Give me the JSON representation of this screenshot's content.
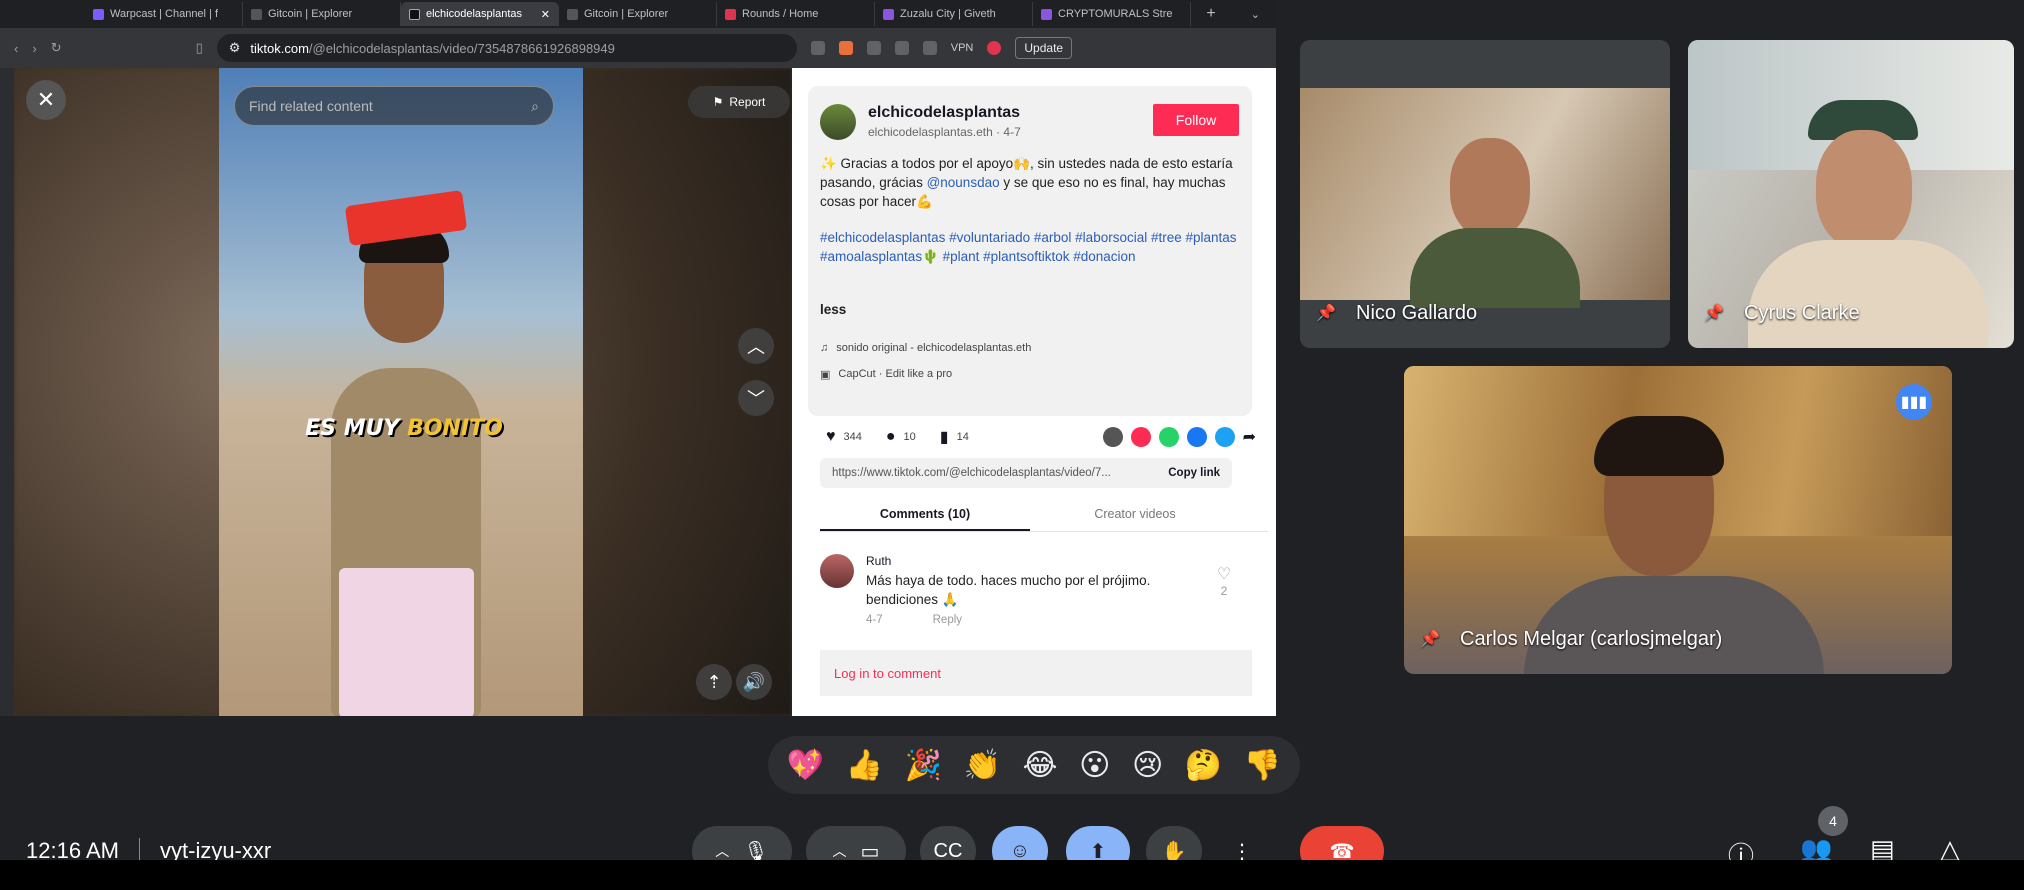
{
  "browser": {
    "tabs": [
      {
        "label": "Warpcast | Channel | f",
        "color": "#7c5cff",
        "active": false
      },
      {
        "label": "Gitcoin | Explorer",
        "color": "#555555",
        "active": false
      },
      {
        "label": "elchicodelasplantas",
        "color": "#111111",
        "active": true
      },
      {
        "label": "Gitcoin | Explorer",
        "color": "#555555",
        "active": false
      },
      {
        "label": "Rounds / Home",
        "color": "#e0334f",
        "active": false
      },
      {
        "label": "Zuzalu City | Giveth",
        "color": "#8a55e0",
        "active": false
      },
      {
        "label": "CRYPTOMURALS Stre",
        "color": "#8a55e0",
        "active": false
      }
    ],
    "url_host": "tiktok.com",
    "url_path": "/@elchicodelasplantas/video/7354878661926898949",
    "vpn_label": "VPN",
    "update_label": "Update"
  },
  "video": {
    "search_placeholder": "Find related content",
    "report_label": "Report",
    "caption_white": "ES MUY",
    "caption_yellow": "BONITO"
  },
  "post": {
    "author": "elchicodelasplantas",
    "author_sub": "elchicodelasplantas.eth · 4-7",
    "follow_label": "Follow",
    "desc_1": "✨ Gracias a todos por el apoyo🙌, sin ustedes nada de esto estaría pasando, grácias ",
    "desc_mention": "@nounsdao",
    "desc_2": " y se que eso no es final, hay muchas cosas por hacer💪",
    "tags": "#elchicodelasplantas #voluntariado #arbol #laborsocial #tree #plantas #amoalasplantas🌵 #plant #plantsoftiktok #donacion",
    "less_label": "less",
    "sound": "sonido original - elchicodelasplantas.eth",
    "capcut": "CapCut · Edit like a pro",
    "likes": "344",
    "comments": "10",
    "saves": "14",
    "share_link": "https://www.tiktok.com/@elchicodelasplantas/video/7...",
    "copy_link_label": "Copy link",
    "tab_comments": "Comments (10)",
    "tab_creator": "Creator videos",
    "comment_user": "Ruth",
    "comment_text": "Más haya de todo. haces mucho por el prójimo. bendiciones 🙏",
    "comment_date": "4-7",
    "comment_reply": "Reply",
    "comment_likes": "2",
    "login_label": "Log in to comment"
  },
  "meet": {
    "participants": [
      {
        "name": "Nico Gallardo"
      },
      {
        "name": "Cyrus Clarke"
      },
      {
        "name": "Carlos Melgar (carlosjmelgar)"
      }
    ],
    "reactions": [
      "💖",
      "👍",
      "🎉",
      "👏",
      "😂",
      "😮",
      "😢",
      "🤔",
      "👎"
    ],
    "time": "12:16 AM",
    "meeting_code": "vyt-izyu-xxr",
    "people_count": "4"
  }
}
